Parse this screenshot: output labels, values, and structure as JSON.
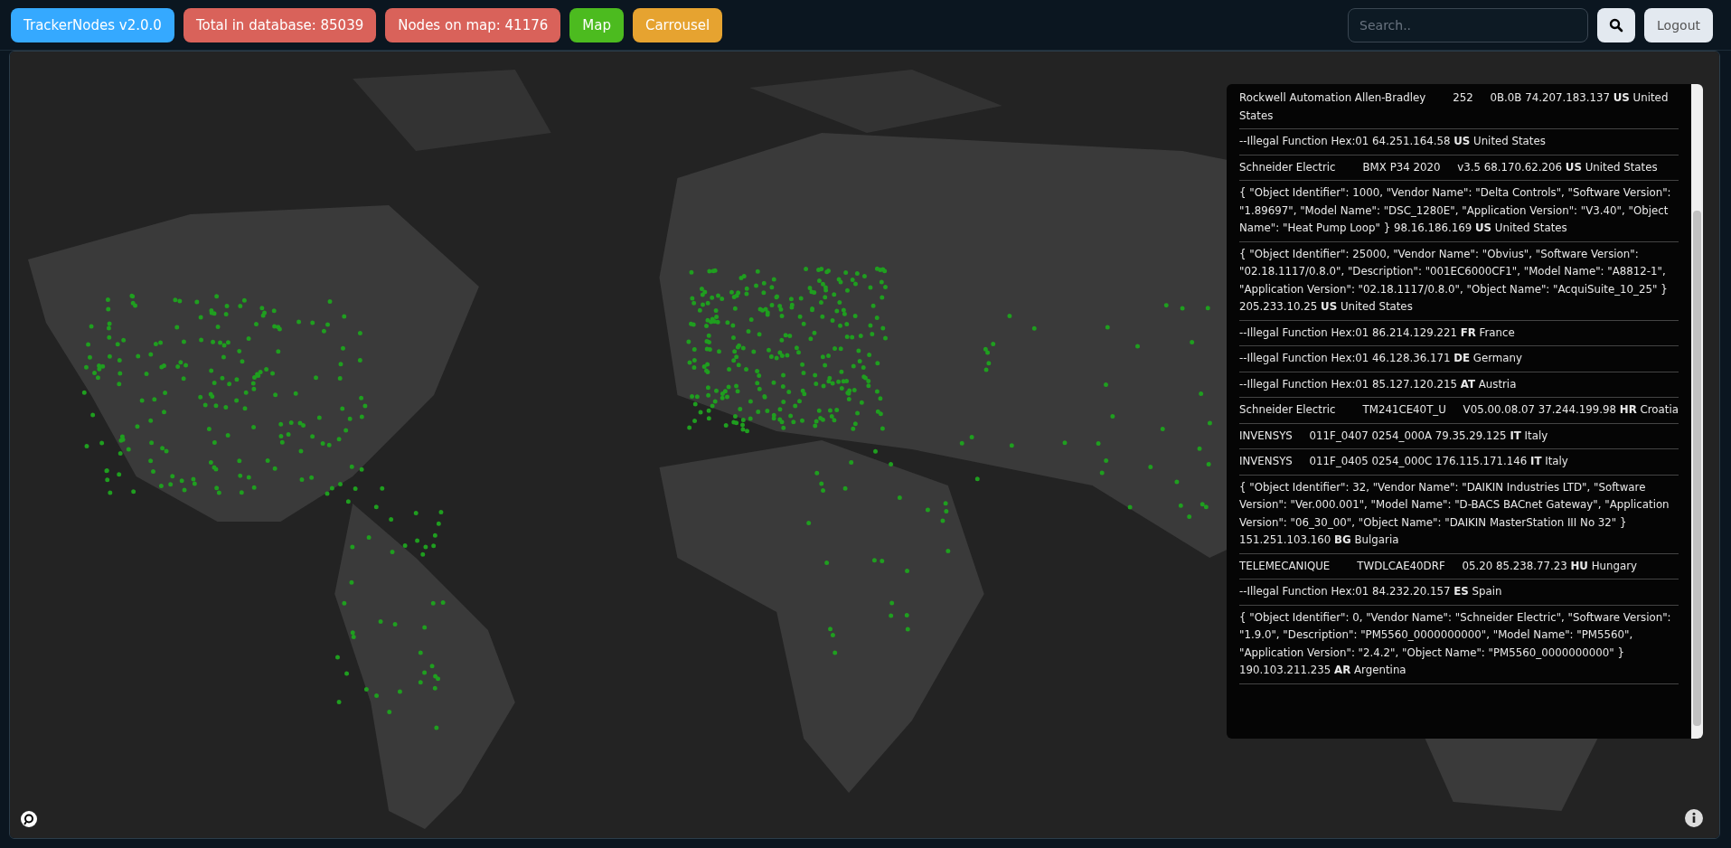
{
  "navbar": {
    "brand": "TrackerNodes v2.0.0",
    "badges": [
      {
        "label": "Total in database: 85039",
        "kind": "stat"
      },
      {
        "label": "Nodes on map: 41176",
        "kind": "stat"
      },
      {
        "label": "Map",
        "kind": "map"
      },
      {
        "label": "Carrousel",
        "kind": "carousel"
      }
    ],
    "search": {
      "placeholder": "Search.."
    },
    "logout": "Logout"
  },
  "results": [
    "Rockwell Automation Allen-Bradley        252     0B.0B 74.207.183.137 **US** United States",
    "--Illegal Function Hex:01 64.251.164.58 **US** United States",
    "Schneider Electric        BMX P34 2020     v3.5 68.170.62.206 **US** United States",
    "{ \"Object Identifier\": 1000, \"Vendor Name\": \"Delta Controls\", \"Software Version\": \"1.89697\", \"Model Name\": \"DSC_1280E\", \"Application Version\": \"V3.40\", \"Object Name\": \"Heat Pump Loop\" } 98.16.186.169 **US** United States",
    "{ \"Object Identifier\": 25000, \"Vendor Name\": \"Obvius\", \"Software Version\": \"02.18.1117/0.8.0\", \"Description\": \"001EC6000CF1\", \"Model Name\": \"A8812-1\", \"Application Version\": \"02.18.1117/0.8.0\", \"Object Name\": \"AcquiSuite_10_25\" } 205.233.10.25 **US** United States",
    "--Illegal Function Hex:01 86.214.129.221 **FR** France",
    "--Illegal Function Hex:01 46.128.36.171 **DE** Germany",
    "--Illegal Function Hex:01 85.127.120.215 **AT** Austria",
    "Schneider Electric        TM241CE40T_U     V05.00.08.07 37.244.199.98 **HR** Croatia",
    "INVENSYS     011F_0407 0254_000A 79.35.29.125 **IT** Italy",
    "INVENSYS     011F_0405 0254_000C 176.115.171.146 **IT** Italy",
    "{ \"Object Identifier\": 32, \"Vendor Name\": \"DAIKIN Industries LTD\", \"Software Version\": \"Ver.000.001\", \"Model Name\": \"D-BACS BACnet Gateway\", \"Application Version\": \"06_30_00\", \"Object Name\": \"DAIKIN MasterStation III No 32\" } 151.251.103.160 **BG** Bulgaria",
    "TELEMECANIQUE        TWDLCAE40DRF     05.20 85.238.77.23 **HU** Hungary",
    "--Illegal Function Hex:01 84.232.20.157 **ES** Spain",
    "{ \"Object Identifier\": 0, \"Vendor Name\": \"Schneider Electric\", \"Software Version\": \"1.9.0\", \"Description\": \"PM5560_0000000000\", \"Model Name\": \"PM5560\", \"Application Version\": \"2.4.2\", \"Object Name\": \"PM5560_0000000000\" } 190.103.211.235 **AR** Argentina"
  ]
}
